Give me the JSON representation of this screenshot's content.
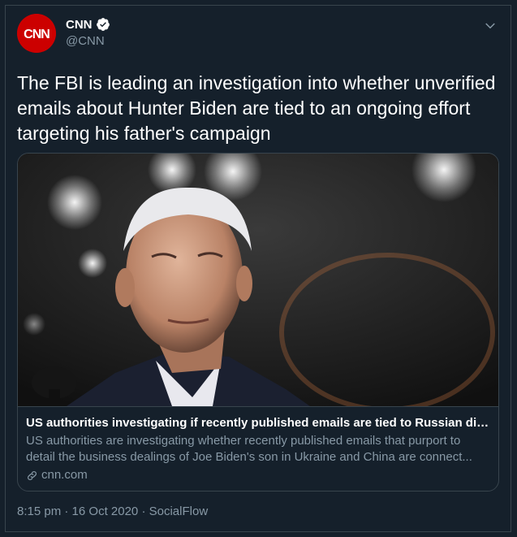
{
  "account": {
    "display_name": "CNN",
    "handle": "@CNN",
    "avatar_text": "CNN"
  },
  "tweet": {
    "text": "The FBI is leading an investigation into whether unverified emails about Hunter Biden are tied to an ongoing effort targeting his father's campaign"
  },
  "card": {
    "title": "US authorities investigating if recently published emails are tied to Russian disinf...",
    "description_line1": "US authorities are investigating whether recently published emails that purport to",
    "description_line2": "detail the business dealings of Joe Biden's son in Ukraine and China are connect...",
    "domain": "cnn.com",
    "image_alt_icon": "photo-of-man"
  },
  "meta": {
    "time": "8:15 pm",
    "separator": " · ",
    "date": "16 Oct 2020",
    "source": "SocialFlow"
  },
  "colors": {
    "background": "#15202b",
    "border": "#38444d",
    "secondary_text": "#8899a6",
    "brand_red": "#cc0000",
    "verified_blue": "#ffffff"
  }
}
